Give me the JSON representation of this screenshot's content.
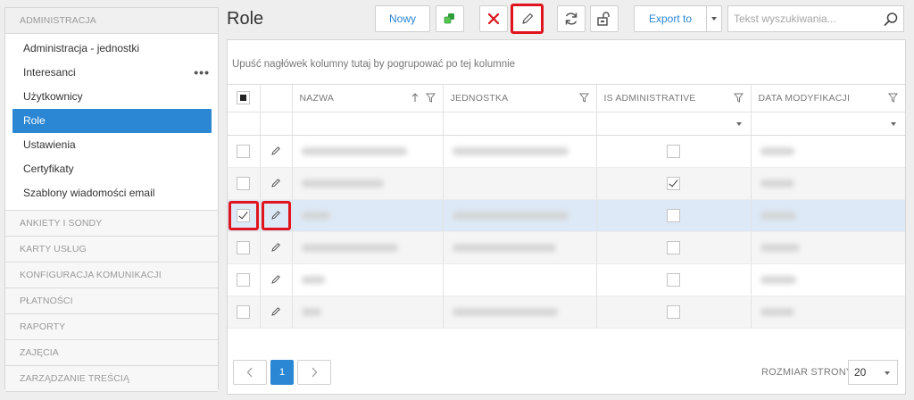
{
  "sidebar": {
    "top_section": "ADMINISTRACJA",
    "items": [
      {
        "label": "Administracja - jednostki"
      },
      {
        "label": "Interesanci",
        "dots": "•••"
      },
      {
        "label": "Użytkownicy"
      },
      {
        "label": "Role"
      },
      {
        "label": "Ustawienia"
      },
      {
        "label": "Certyfikaty"
      },
      {
        "label": "Szablony wiadomości email"
      }
    ],
    "sections": [
      "ANKIETY I SONDY",
      "KARTY USŁUG",
      "KONFIGURACJA KOMUNIKACJI",
      "PŁATNOŚCI",
      "RAPORTY",
      "ZAJĘCIA",
      "ZARZĄDZANIE TREŚCIĄ"
    ]
  },
  "header": {
    "title": "Role",
    "new_label": "Nowy",
    "export_label": "Export to",
    "search_placeholder": "Tekst wyszukiwania..."
  },
  "grid": {
    "group_hint": "Upuść nagłówek kolumny tutaj by pogrupować po tej kolumnie",
    "columns": {
      "name": "NAZWA",
      "unit": "JEDNOSTKA",
      "admin": "IS ADMINISTRATIVE",
      "date": "DATA MODYFIKACJI"
    },
    "rows": [
      {
        "selected": false,
        "is_admin": false
      },
      {
        "selected": false,
        "is_admin": true
      },
      {
        "selected": true,
        "is_admin": false
      },
      {
        "selected": false,
        "is_admin": false
      },
      {
        "selected": false,
        "is_admin": false
      },
      {
        "selected": false,
        "is_admin": false
      }
    ]
  },
  "pager": {
    "current_page": "1",
    "page_size_label": "ROZMIAR STRONY",
    "page_size": "20"
  },
  "colors": {
    "accent": "#2b86d3",
    "highlight": "#e0141e",
    "selected_row": "#dde9f6"
  }
}
